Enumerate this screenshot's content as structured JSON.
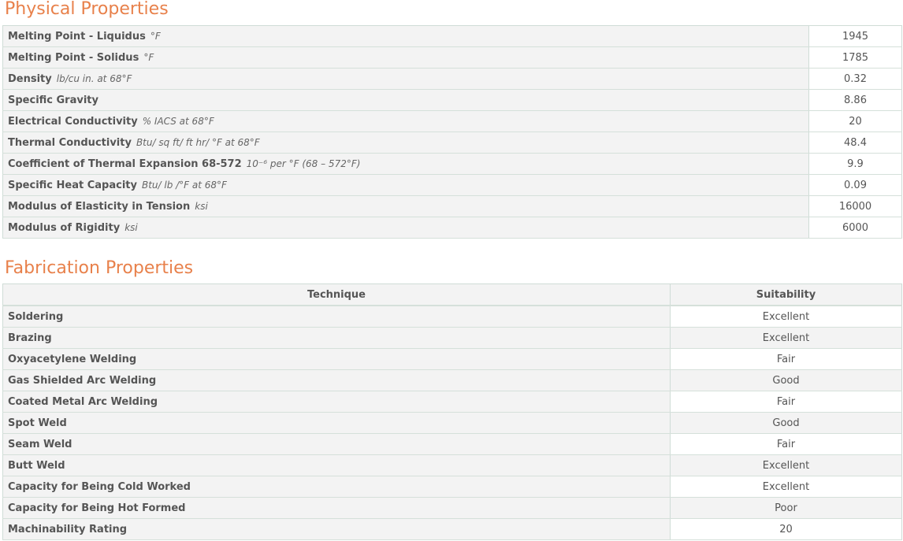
{
  "physical": {
    "title": "Physical Properties",
    "rows": [
      {
        "label": "Melting Point - Liquidus",
        "unit": "°F",
        "value": "1945"
      },
      {
        "label": "Melting Point - Solidus",
        "unit": "°F",
        "value": "1785"
      },
      {
        "label": "Density",
        "unit": "lb/cu in. at 68°F",
        "value": "0.32"
      },
      {
        "label": "Specific Gravity",
        "unit": "",
        "value": "8.86"
      },
      {
        "label": "Electrical Conductivity",
        "unit": "% IACS at 68°F",
        "value": "20"
      },
      {
        "label": "Thermal Conductivity",
        "unit": "Btu/ sq ft/ ft hr/ °F at 68°F",
        "value": "48.4"
      },
      {
        "label": "Coefficient of Thermal Expansion 68-572",
        "unit": "10⁻⁶ per °F (68 – 572°F)",
        "value": "9.9"
      },
      {
        "label": "Specific Heat Capacity",
        "unit": "Btu/ lb /°F at 68°F",
        "value": "0.09"
      },
      {
        "label": "Modulus of Elasticity in Tension",
        "unit": "ksi",
        "value": "16000"
      },
      {
        "label": "Modulus of Rigidity",
        "unit": "ksi",
        "value": "6000"
      }
    ]
  },
  "fabrication": {
    "title": "Fabrication Properties",
    "headers": {
      "technique": "Technique",
      "suitability": "Suitability"
    },
    "rows": [
      {
        "technique": "Soldering",
        "suitability": "Excellent"
      },
      {
        "technique": "Brazing",
        "suitability": "Excellent"
      },
      {
        "technique": "Oxyacetylene Welding",
        "suitability": "Fair"
      },
      {
        "technique": "Gas Shielded Arc Welding",
        "suitability": "Good"
      },
      {
        "technique": "Coated Metal Arc Welding",
        "suitability": "Fair"
      },
      {
        "technique": "Spot Weld",
        "suitability": "Good"
      },
      {
        "technique": "Seam Weld",
        "suitability": "Fair"
      },
      {
        "technique": "Butt Weld",
        "suitability": "Excellent"
      },
      {
        "technique": "Capacity for Being Cold Worked",
        "suitability": "Excellent"
      },
      {
        "technique": "Capacity for Being Hot Formed",
        "suitability": "Poor"
      },
      {
        "technique": "Machinability Rating",
        "suitability": "20"
      }
    ]
  }
}
